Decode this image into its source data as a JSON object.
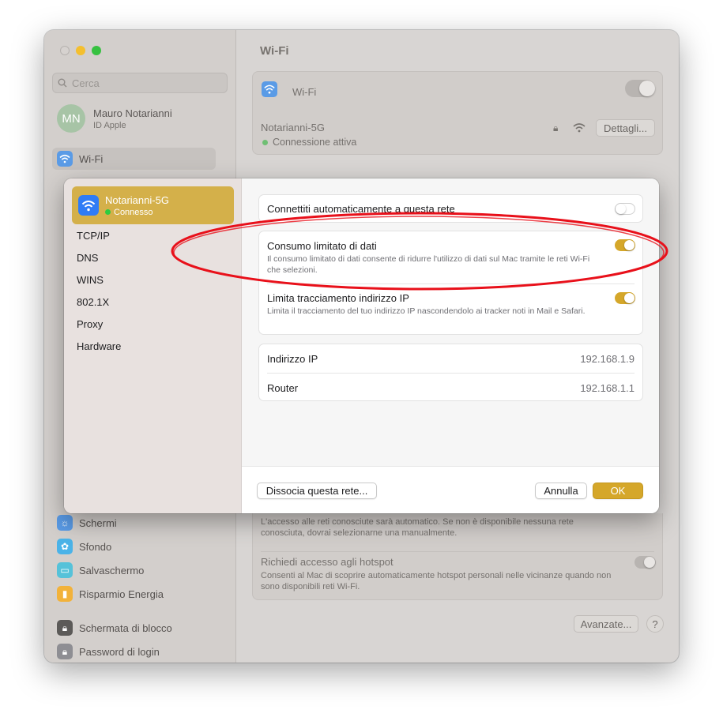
{
  "window": {
    "title": "Wi-Fi",
    "sidebar": {
      "search_placeholder": "Cerca",
      "user": {
        "initials": "MN",
        "name": "Mauro Notarianni",
        "subtitle": "ID Apple"
      },
      "selected_item": "Wi-Fi",
      "items_bottom": [
        {
          "label": "Schermi",
          "icon": "display-icon",
          "color": "#5a9be6"
        },
        {
          "label": "Sfondo",
          "icon": "wallpaper-icon",
          "color": "#4bb3e8"
        },
        {
          "label": "Salvaschermo",
          "icon": "screensaver-icon",
          "color": "#56c2d9"
        },
        {
          "label": "Risparmio Energia",
          "icon": "battery-icon",
          "color": "#f2b23a"
        },
        {
          "label": "Schermata di blocco",
          "icon": "lock-icon",
          "color": "#3a3a3c"
        },
        {
          "label": "Password di login",
          "icon": "password-icon",
          "color": "#8e8e93"
        }
      ]
    },
    "wifi_card": {
      "label": "Wi-Fi",
      "network_name": "Notarianni-5G",
      "network_status": "Connessione attiva",
      "details_button": "Dettagli..."
    },
    "auto_join_desc": "L'accesso alle reti conosciute sarà automatico. Se non è disponibile nessuna rete conosciuta, dovrai selezionarne una manualmente.",
    "hotspot": {
      "title": "Richiedi accesso agli hotspot",
      "desc": "Consenti al Mac di scoprire automaticamente hotspot personali nelle vicinanze quando non sono disponibili reti Wi-Fi."
    },
    "advanced_button": "Avanzate...",
    "help_button": "?"
  },
  "dialog": {
    "network": {
      "name": "Notarianni-5G",
      "status": "Connesso"
    },
    "nav": [
      "TCP/IP",
      "DNS",
      "WINS",
      "802.1X",
      "Proxy",
      "Hardware"
    ],
    "auto_connect": {
      "label": "Connettiti automaticamente a questa rete",
      "on": false
    },
    "low_data": {
      "label": "Consumo limitato di dati",
      "desc": "Il consumo limitato di dati consente di ridurre l'utilizzo di dati sul Mac tramite le reti Wi-Fi che selezioni.",
      "on": true
    },
    "limit_tracking": {
      "label": "Limita tracciamento indirizzo IP",
      "desc": "Limita il tracciamento del tuo indirizzo IP nascondendolo ai tracker noti in Mail e Safari.",
      "on": true
    },
    "ip": {
      "label": "Indirizzo IP",
      "value": "192.168.1.9"
    },
    "router": {
      "label": "Router",
      "value": "192.168.1.1"
    },
    "buttons": {
      "forget": "Dissocia questa rete...",
      "cancel": "Annulla",
      "ok": "OK"
    }
  },
  "colors": {
    "accent": "#d5a72a",
    "selection": "#d4b04a",
    "wifi_blue": "#2f7cf6",
    "annotation": "#e8101a"
  }
}
